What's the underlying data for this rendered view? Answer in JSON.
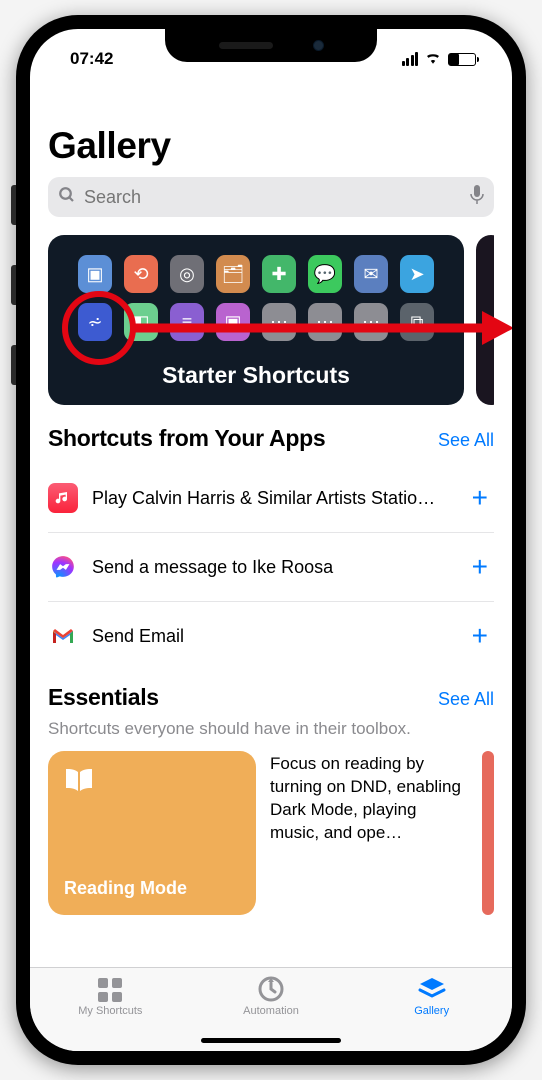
{
  "status": {
    "time": "07:42"
  },
  "title": "Gallery",
  "search": {
    "placeholder": "Search"
  },
  "hero": {
    "title": "Starter Shortcuts"
  },
  "appsSection": {
    "title": "Shortcuts from Your Apps",
    "seeAll": "See All",
    "rows": [
      {
        "label": "Play Calvin Harris & Similar Artists Statio…"
      },
      {
        "label": "Send a message to Ike Roosa"
      },
      {
        "label": "Send Email"
      }
    ]
  },
  "essentials": {
    "title": "Essentials",
    "seeAll": "See All",
    "subtitle": "Shortcuts everyone should have in their toolbox.",
    "card": {
      "title": "Reading Mode"
    },
    "desc": "Focus on reading by turning on DND, enabling Dark Mode, playing music, and ope…"
  },
  "tabs": {
    "shortcuts": "My Shortcuts",
    "automation": "Automation",
    "gallery": "Gallery"
  },
  "colors": {
    "accent": "#007aff",
    "annotation": "#e30613",
    "ess_card": "#f0ae58"
  },
  "heroIcons": {
    "row1": [
      {
        "bg": "#5c8fd6"
      },
      {
        "bg": "#e96d50"
      },
      {
        "bg": "#6f6f76"
      },
      {
        "bg": "#d28b4f"
      },
      {
        "bg": "#43b76a"
      },
      {
        "bg": "#3cc95e"
      },
      {
        "bg": "#5b7fbf"
      },
      {
        "bg": "#3ba4e0"
      }
    ],
    "row2": [
      {
        "bg": "#3d5bd1"
      },
      {
        "bg": "#6ccf8f"
      },
      {
        "bg": "#8a5fd1"
      },
      {
        "bg": "#b963cf"
      },
      {
        "bg": "#8d8d93"
      },
      {
        "bg": "#8d8d93"
      },
      {
        "bg": "#8d8d93"
      },
      {
        "bg": "#5b636b"
      }
    ]
  }
}
